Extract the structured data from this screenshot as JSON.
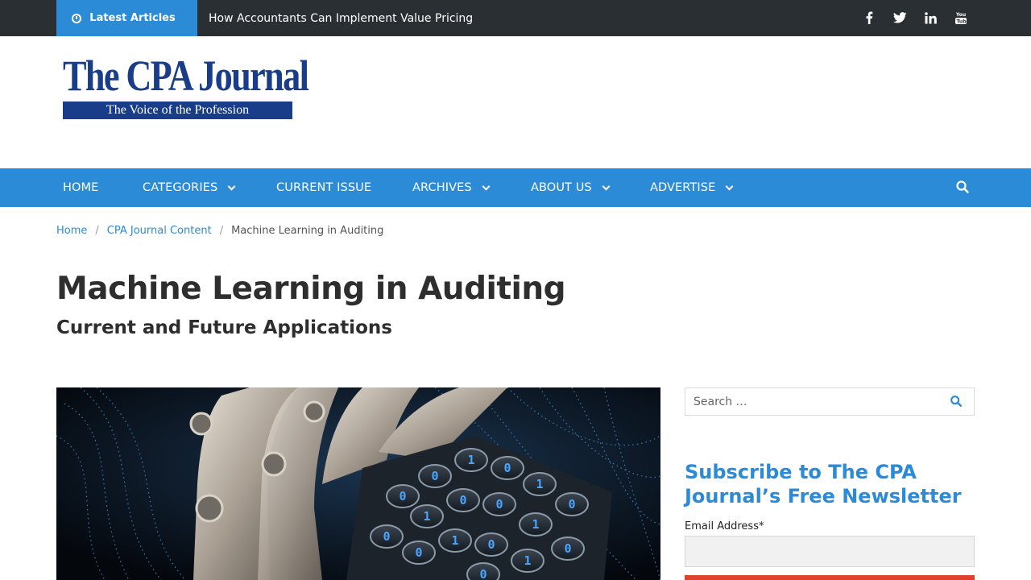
{
  "topbar": {
    "latest_label": "Latest Articles",
    "latest_title": "How Accountants Can Implement Value Pricing",
    "social": [
      "facebook-icon",
      "twitter-icon",
      "linkedin-icon",
      "youtube-icon"
    ]
  },
  "logo": {
    "name": "The CPA Journal",
    "tagline": "The Voice of the Profession"
  },
  "nav": {
    "items": [
      {
        "label": "HOME",
        "dropdown": false
      },
      {
        "label": "CATEGORIES",
        "dropdown": true
      },
      {
        "label": "CURRENT ISSUE",
        "dropdown": false
      },
      {
        "label": "ARCHIVES",
        "dropdown": true
      },
      {
        "label": "ABOUT US",
        "dropdown": true
      },
      {
        "label": "ADVERTISE",
        "dropdown": true
      }
    ]
  },
  "breadcrumb": {
    "home": "Home",
    "section": "CPA Journal Content",
    "current": "Machine Learning in Auditing"
  },
  "article": {
    "title": "Machine Learning in Auditing",
    "subtitle": "Current and Future Applications"
  },
  "sidebar": {
    "search_placeholder": "Search …",
    "subscribe_title": "Subscribe to The CPA Journal’s Free Newsletter",
    "email_label": "Email Address*"
  },
  "colors": {
    "accent": "#2b8bd6",
    "topbar": "#2a2f33",
    "logo": "#1a3d8a",
    "submit": "#e0412f"
  }
}
